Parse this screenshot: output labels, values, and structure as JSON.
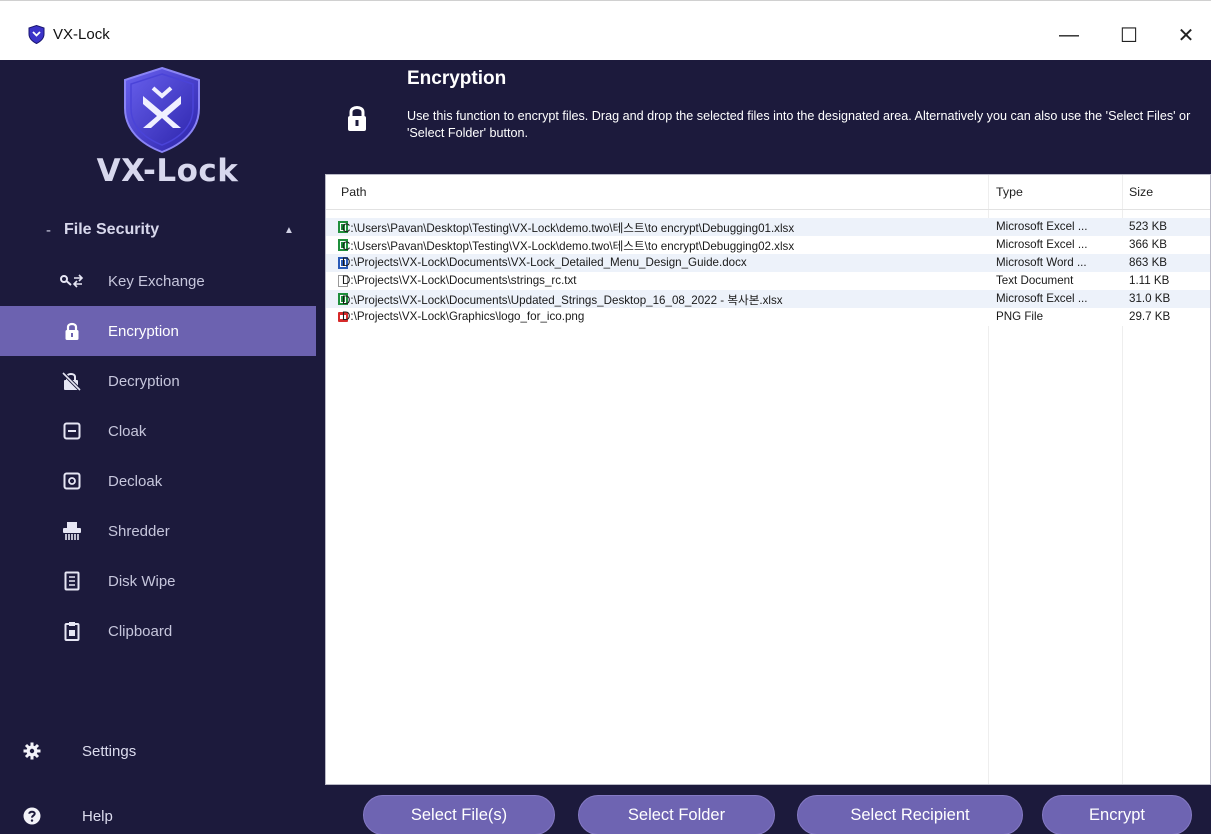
{
  "window": {
    "title": "VX-Lock",
    "minimize_glyph": "—",
    "maximize_glyph": "☐",
    "close_glyph": "✕"
  },
  "brand": {
    "name": "VX-Lock",
    "shield_color": "#3b33c9",
    "accent_color": "#6c62b0"
  },
  "sidebar": {
    "section": {
      "prefix": "-",
      "label": "File Security",
      "caret": "▲"
    },
    "items": [
      {
        "label": "Key Exchange",
        "icon": "key-exchange-icon",
        "active": false
      },
      {
        "label": "Encryption",
        "icon": "lock-icon",
        "active": true
      },
      {
        "label": "Decryption",
        "icon": "unlock-icon",
        "active": false
      },
      {
        "label": "Cloak",
        "icon": "cloak-icon",
        "active": false
      },
      {
        "label": "Decloak",
        "icon": "decloak-icon",
        "active": false
      },
      {
        "label": "Shredder",
        "icon": "shredder-icon",
        "active": false
      },
      {
        "label": "Disk Wipe",
        "icon": "disk-wipe-icon",
        "active": false
      },
      {
        "label": "Clipboard",
        "icon": "clipboard-icon",
        "active": false
      }
    ],
    "bottom": [
      {
        "label": "Settings",
        "icon": "gear-icon"
      },
      {
        "label": "Help",
        "icon": "help-icon"
      }
    ]
  },
  "header": {
    "title": "Encryption",
    "description": "Use this function to encrypt files.  Drag and drop the selected files into the designated area.  Alternatively you can also use the 'Select Files' or 'Select Folder' button."
  },
  "file_list": {
    "columns": [
      "Path",
      "Type",
      "Size"
    ],
    "rows": [
      {
        "path": "C:\\Users\\Pavan\\Desktop\\Testing\\VX-Lock\\demo.two\\테스트\\to encrypt\\Debugging01.xlsx",
        "type": "Microsoft Excel ...",
        "size": "523 KB",
        "icon": "excel-file-icon"
      },
      {
        "path": "C:\\Users\\Pavan\\Desktop\\Testing\\VX-Lock\\demo.two\\테스트\\to encrypt\\Debugging02.xlsx",
        "type": "Microsoft Excel ...",
        "size": "366 KB",
        "icon": "excel-file-icon"
      },
      {
        "path": "D:\\Projects\\VX-Lock\\Documents\\VX-Lock_Detailed_Menu_Design_Guide.docx",
        "type": "Microsoft Word ...",
        "size": "863 KB",
        "icon": "word-file-icon"
      },
      {
        "path": "D:\\Projects\\VX-Lock\\Documents\\strings_rc.txt",
        "type": "Text Document",
        "size": "1.11 KB",
        "icon": "text-file-icon"
      },
      {
        "path": "D:\\Projects\\VX-Lock\\Documents\\Updated_Strings_Desktop_16_08_2022 - 복사본.xlsx",
        "type": "Microsoft Excel ...",
        "size": "31.0 KB",
        "icon": "excel-file-icon"
      },
      {
        "path": "D:\\Projects\\VX-Lock\\Graphics\\logo_for_ico.png",
        "type": "PNG File",
        "size": "29.7 KB",
        "icon": "image-file-icon"
      }
    ]
  },
  "actions": {
    "select_files": "Select File(s)",
    "select_folder": "Select Folder",
    "select_recipient": "Select Recipient",
    "encrypt": "Encrypt"
  }
}
